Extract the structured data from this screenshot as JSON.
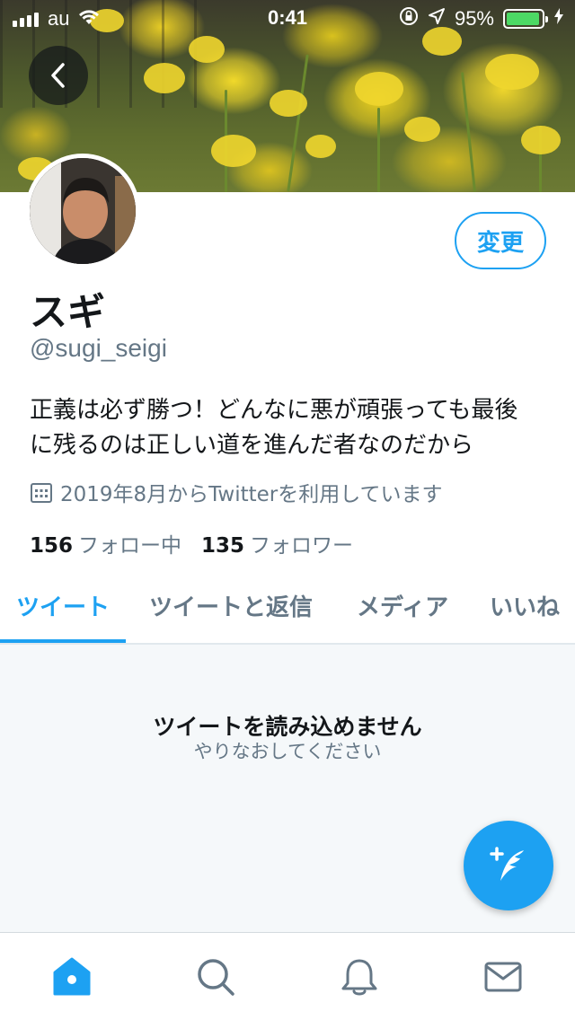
{
  "status_bar": {
    "carrier": "au",
    "time": "0:41",
    "battery": "95%",
    "battery_level": 0.95
  },
  "profile": {
    "display_name": "スギ",
    "handle": "@sugi_seigi",
    "bio_line1": "正義は必ず勝つ！どんなに悪が頑張っても最後",
    "bio_line2": "に残るのは正しい道を進んだ者なのだから",
    "joined": "2019年8月からTwitterを利用しています",
    "following_count": "156",
    "following_label": "フォロー中",
    "followers_count": "135",
    "followers_label": "フォロワー",
    "edit_button": "変更"
  },
  "tabs": [
    {
      "label": "ツイート",
      "active": true
    },
    {
      "label": "ツイートと返信",
      "active": false
    },
    {
      "label": "メディア",
      "active": false
    },
    {
      "label": "いいね",
      "active": false
    }
  ],
  "content": {
    "error_title": "ツイートを読み込めません",
    "error_subtitle": "やりなおしてください"
  },
  "icons": {
    "back": "chevron-left-icon",
    "compose": "compose-tweet-icon",
    "home": "home-icon",
    "search": "search-icon",
    "notifications": "bell-icon",
    "messages": "mail-icon",
    "calendar": "calendar-icon"
  },
  "colors": {
    "accent": "#1da1f2",
    "text_secondary": "#657786",
    "battery_fill": "#4cd964"
  }
}
